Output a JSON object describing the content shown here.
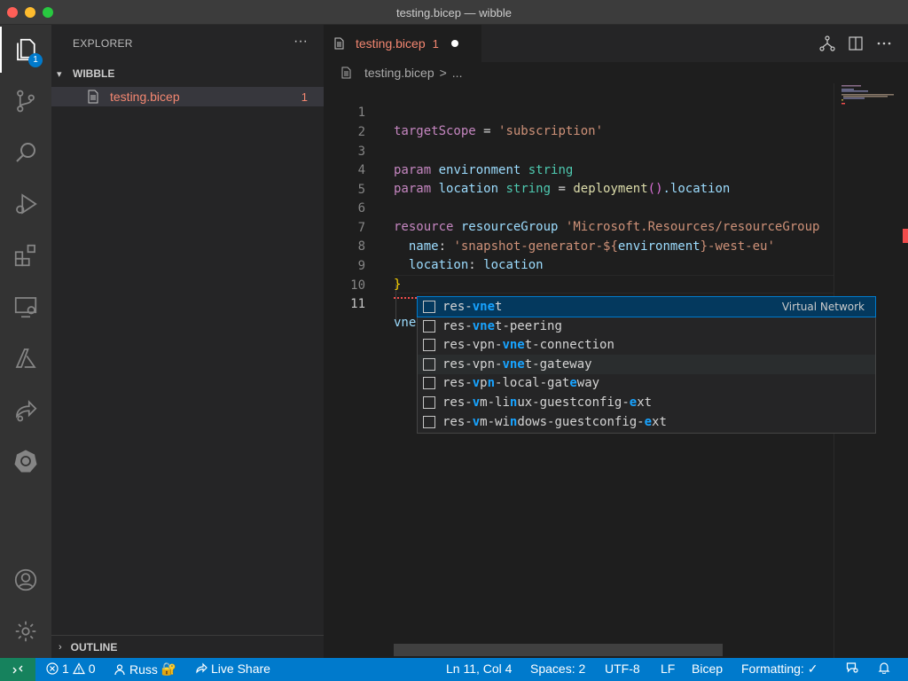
{
  "window": {
    "title": "testing.bicep — wibble"
  },
  "activity_bar": {
    "explorer_badge": "1",
    "icons": [
      "files-icon",
      "source-control-icon",
      "search-icon",
      "run-debug-icon",
      "extensions-icon",
      "remote-explorer-icon",
      "azure-icon",
      "live-share-icon",
      "kubernetes-icon",
      "account-icon",
      "settings-gear-icon"
    ]
  },
  "sidebar": {
    "title": "EXPLORER",
    "more": "···",
    "folder": "WIBBLE",
    "file": {
      "name": "testing.bicep",
      "problems": "1"
    },
    "outline": "OUTLINE"
  },
  "tab": {
    "name": "testing.bicep",
    "problems": "1"
  },
  "breadcrumb": {
    "file": "testing.bicep",
    "sep": ">",
    "more": "..."
  },
  "editor": {
    "line_numbers": [
      "1",
      "2",
      "3",
      "4",
      "5",
      "6",
      "7",
      "8",
      "9",
      "10",
      "11"
    ],
    "lines": {
      "l1_kw": "targetScope",
      "l1_eq": " = ",
      "l1_str": "'subscription'",
      "l3_kw": "param",
      "l3_name": "environment",
      "l3_type": "string",
      "l4_kw": "param",
      "l4_name": "location",
      "l4_type": "string",
      "l4_eq": " = ",
      "l4_fn": "deployment",
      "l4_paren": "()",
      "l4_prop": ".location",
      "l6_kw": "resource",
      "l6_name": "resourceGroup",
      "l6_str": "'Microsoft.Resources/resourceGroup",
      "l7_key": "name",
      "l7_colon": ": ",
      "l7_str1": "'snapshot-generator-",
      "l7_interp_open": "${",
      "l7_interp": "environment",
      "l7_interp_close": "}",
      "l7_str2": "-west-eu'",
      "l8_key": "location",
      "l8_colon": ": ",
      "l8_val": "location",
      "l9_brace": "}",
      "l11_text": "vne"
    }
  },
  "suggestions": [
    {
      "parts": [
        "res-",
        "vne",
        "t"
      ],
      "detail": "Virtual Network"
    },
    {
      "parts": [
        "res-",
        "vne",
        "t-peering"
      ]
    },
    {
      "parts": [
        "res-vpn-",
        "vne",
        "t-connection"
      ]
    },
    {
      "parts": [
        "res-vpn-",
        "vne",
        "t-gateway"
      ]
    },
    {
      "parts": [
        "res-",
        "v",
        "p",
        "n",
        "-local-gat",
        "e",
        "way"
      ]
    },
    {
      "parts": [
        "res-",
        "v",
        "m-li",
        "n",
        "ux-guestconfig-",
        "e",
        "xt"
      ]
    },
    {
      "parts": [
        "res-",
        "v",
        "m-wi",
        "n",
        "dows-guestconfig-",
        "e",
        "xt"
      ]
    }
  ],
  "status_bar": {
    "errors": "1",
    "warnings": "0",
    "user": "Russ",
    "live_share": "Live Share",
    "position": "Ln 11, Col 4",
    "spaces": "Spaces: 2",
    "encoding": "UTF-8",
    "eol": "LF",
    "language": "Bicep",
    "formatting": "Formatting: ✓"
  },
  "colors": {
    "accent": "#007acc",
    "error": "#f48771",
    "remote": "#16825d"
  }
}
